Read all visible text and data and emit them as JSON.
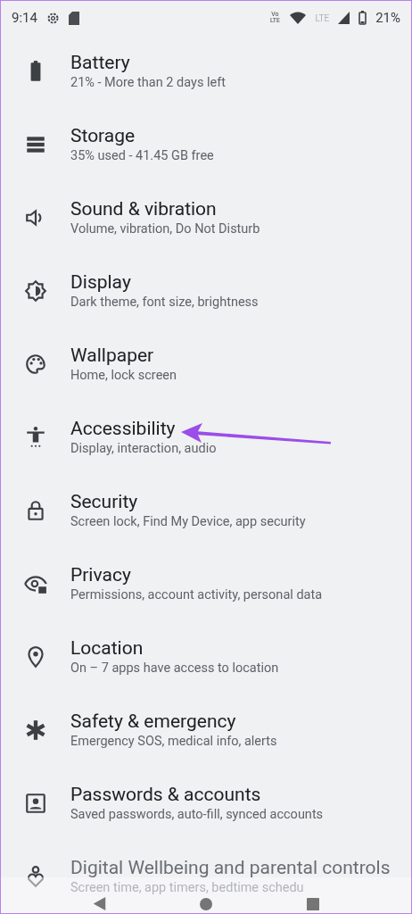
{
  "status_bar": {
    "time": "9:14",
    "volte": "Vo LTE",
    "lte": "LTE",
    "battery": "21%"
  },
  "settings": [
    {
      "title": "Battery",
      "subtitle": "21% - More than 2 days left"
    },
    {
      "title": "Storage",
      "subtitle": "35% used - 41.45 GB free"
    },
    {
      "title": "Sound & vibration",
      "subtitle": "Volume, vibration, Do Not Disturb"
    },
    {
      "title": "Display",
      "subtitle": "Dark theme, font size, brightness"
    },
    {
      "title": "Wallpaper",
      "subtitle": "Home, lock screen"
    },
    {
      "title": "Accessibility",
      "subtitle": "Display, interaction, audio"
    },
    {
      "title": "Security",
      "subtitle": "Screen lock, Find My Device, app security"
    },
    {
      "title": "Privacy",
      "subtitle": "Permissions, account activity, personal data"
    },
    {
      "title": "Location",
      "subtitle": "On – 7 apps have access to location"
    },
    {
      "title": "Safety & emergency",
      "subtitle": "Emergency SOS, medical info, alerts"
    },
    {
      "title": "Passwords & accounts",
      "subtitle": "Saved passwords, auto-fill, synced accounts"
    },
    {
      "title": "Digital Wellbeing and parental controls",
      "subtitle": "Screen time, app timers, bedtime schedu"
    }
  ]
}
